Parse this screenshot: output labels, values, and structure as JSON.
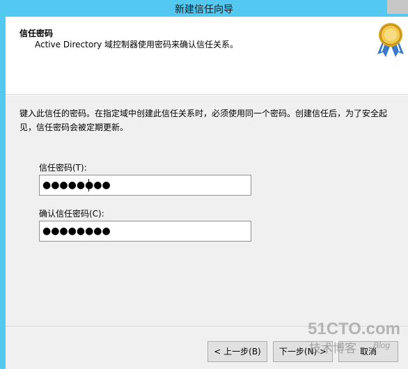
{
  "window": {
    "title": "新建信任向导"
  },
  "header": {
    "title": "信任密码",
    "subtitle": "Active Directory 域控制器使用密码来确认信任关系。"
  },
  "content": {
    "description": "键入此信任的密码。在指定域中创建此信任关系时，必须使用同一个密码。创建信任后，为了安全起见，信任密码会被定期更新。",
    "password": {
      "label": "信任密码(T):",
      "value": "●●●●●●●●"
    },
    "confirm": {
      "label": "确认信任密码(C):",
      "value": "●●●●●●●●"
    }
  },
  "buttons": {
    "back": "< 上一步(B)",
    "next": "下一步(N) >",
    "cancel": "取消"
  },
  "watermark": {
    "main": "51CTO.com",
    "sub": "技术博客",
    "blog": "Blog"
  }
}
